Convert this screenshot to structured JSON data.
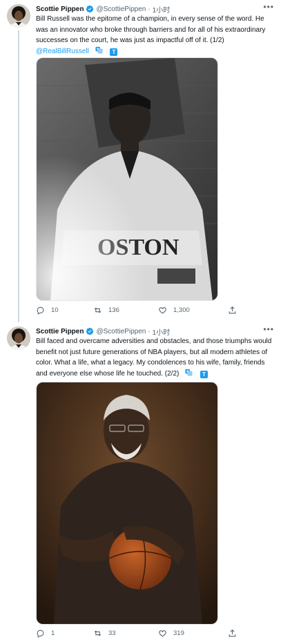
{
  "tweets": [
    {
      "author_name": "Scottie Pippen",
      "handle": "@ScottiePippen",
      "separator": "·",
      "time": "1小时",
      "text": "Bill Russell was the epitome of a champion, in every sense of the word. He was an innovator who broke through barriers and for all of his extraordinary successes on the court, he was just as impactful off of it. (1/2)",
      "mention": "@RealBillRussell",
      "counts": {
        "replies": "10",
        "retweets": "136",
        "likes": "1,300"
      }
    },
    {
      "author_name": "Scottie Pippen",
      "handle": "@ScottiePippen",
      "separator": "·",
      "time": "1小时",
      "text": "Bill faced and overcame adversities and obstacles, and those triumphs would benefit not just future generations of NBA players, but all modern athletes of color. What a life, what a legacy. My condolences to his wife, family, friends and everyone else whose life he touched. (2/2)",
      "counts": {
        "replies": "1",
        "retweets": "33",
        "likes": "319"
      }
    }
  ],
  "colors": {
    "accent": "#1d9bf0",
    "secondary_text": "#536471",
    "thread_line": "#cfd9de"
  },
  "icons": [
    "verified-badge-icon",
    "more-icon",
    "translate-icon",
    "reply-icon",
    "retweet-icon",
    "like-icon",
    "share-icon"
  ]
}
